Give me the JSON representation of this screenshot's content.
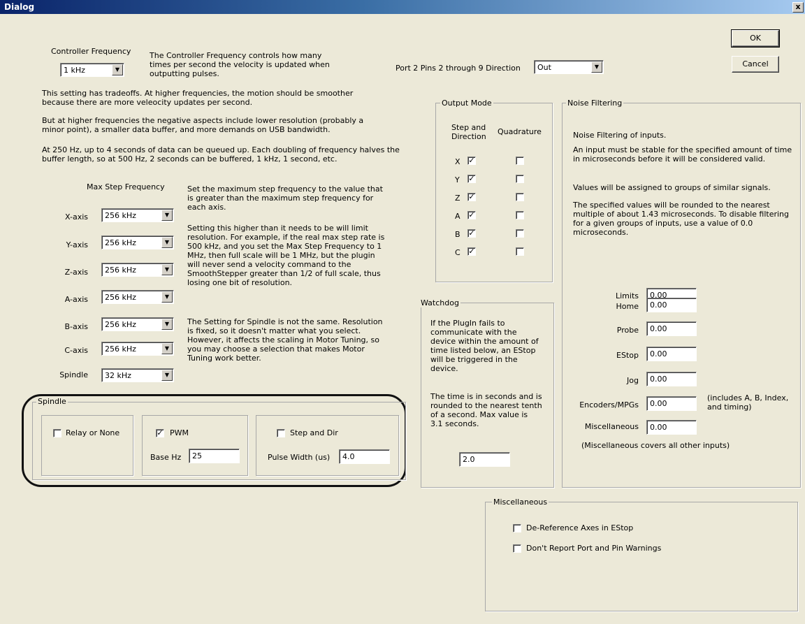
{
  "window": {
    "title": "Dialog",
    "close_label": "x"
  },
  "buttons": {
    "ok": "OK",
    "cancel": "Cancel"
  },
  "controller": {
    "label": "Controller Frequency",
    "value": "1 kHz",
    "desc": "The Controller Frequency controls how many times per second the velocity is updated when outputting pulses.",
    "p1": "This setting has tradeoffs.  At higher frequencies, the motion should be smoother because there are more veleocity updates per second.",
    "p2": "But at higher frequencies the negative aspects include lower resolution (probably a minor point), a smaller data buffer, and more demands on USB bandwidth.",
    "p3": "At 250 Hz, up to 4 seconds of data can be queued up.  Each doubling of frequency halves the buffer length, so at 500 Hz, 2 seconds can be buffered, 1 kHz, 1 second, etc."
  },
  "port": {
    "label": "Port 2 Pins 2 through 9 Direction",
    "value": "Out"
  },
  "max_step": {
    "label": "Max Step Frequency",
    "axes": [
      {
        "label": "X-axis",
        "value": "256 kHz"
      },
      {
        "label": "Y-axis",
        "value": "256 kHz"
      },
      {
        "label": "Z-axis",
        "value": "256 kHz"
      },
      {
        "label": "A-axis",
        "value": "256 kHz"
      },
      {
        "label": "B-axis",
        "value": "256 kHz"
      },
      {
        "label": "C-axis",
        "value": "256 kHz"
      },
      {
        "label": "Spindle",
        "value": "32 kHz"
      }
    ],
    "p1": "Set the maximum step frequency to the value that is greater than the maximum step frequency for each axis.",
    "p2": "Setting this higher than it needs to be will limit resolution.  For example, if the real max step rate is 500 kHz, and you set the Max Step Frequency to 1 MHz, then full scale will be 1 MHz, but the plugin will never send a velocity command to the SmoothStepper greater than 1/2 of full scale, thus losing one bit of resolution.",
    "p3": "The Setting for Spindle is not the same. Resolution is fixed, so it doesn't matter what you select.  However, it affects the scaling in Motor Tuning, so you may choose a selection that makes Motor Tuning work better."
  },
  "spindle": {
    "title": "Spindle",
    "relay": {
      "label": "Relay or None",
      "checked": false
    },
    "pwm": {
      "label": "PWM",
      "checked": true,
      "base_label": "Base Hz",
      "base_value": "25"
    },
    "step_dir": {
      "label": "Step and Dir",
      "checked": false,
      "pulse_label": "Pulse Width (us)",
      "pulse_value": "4.0"
    }
  },
  "output_mode": {
    "title": "Output Mode",
    "col1": "Step and Direction",
    "col2": "Quadrature",
    "rows": [
      {
        "axis": "X",
        "step": true,
        "quad": false
      },
      {
        "axis": "Y",
        "step": true,
        "quad": false
      },
      {
        "axis": "Z",
        "step": true,
        "quad": false
      },
      {
        "axis": "A",
        "step": true,
        "quad": false
      },
      {
        "axis": "B",
        "step": true,
        "quad": false
      },
      {
        "axis": "C",
        "step": true,
        "quad": false
      }
    ]
  },
  "watchdog": {
    "title": "Watchdog",
    "p1": "If the PlugIn fails to communicate with the device within the amount of time listed below, an EStop will be triggered in the device.",
    "p2": "The time is in seconds and is rounded to the nearest tenth of a second.  Max value is 3.1 seconds.",
    "value": "2.0"
  },
  "noise": {
    "title": "Noise Filtering",
    "p1": "Noise Filtering of inputs.",
    "p2": "An input must be stable for the specified amount of time in microseconds before it will be considered valid.",
    "p3": "Values will be assigned to groups of similar signals.",
    "p4": "The specified values will be rounded to the nearest multiple of about 1.43 microseconds.  To disable filtering for a given groups of inputs, use a value of 0.0 microseconds.",
    "fields": [
      {
        "label": "Limits",
        "value": "0.00"
      },
      {
        "label": "Home",
        "value": "0.00"
      },
      {
        "label": "Probe",
        "value": "0.00"
      },
      {
        "label": "EStop",
        "value": "0.00"
      },
      {
        "label": "Jog",
        "value": "0.00"
      },
      {
        "label": "Encoders/MPGs",
        "value": "0.00"
      },
      {
        "label": "Miscellaneous",
        "value": "0.00"
      }
    ],
    "enc_note": "(includes A, B, Index, and timing)",
    "misc_note": "(Miscellaneous covers all other inputs)"
  },
  "misc": {
    "title": "Miscellaneous",
    "deref": {
      "label": "De-Reference Axes in EStop",
      "checked": false
    },
    "nowarn": {
      "label": "Don't Report Port and Pin Warnings",
      "checked": false
    }
  }
}
